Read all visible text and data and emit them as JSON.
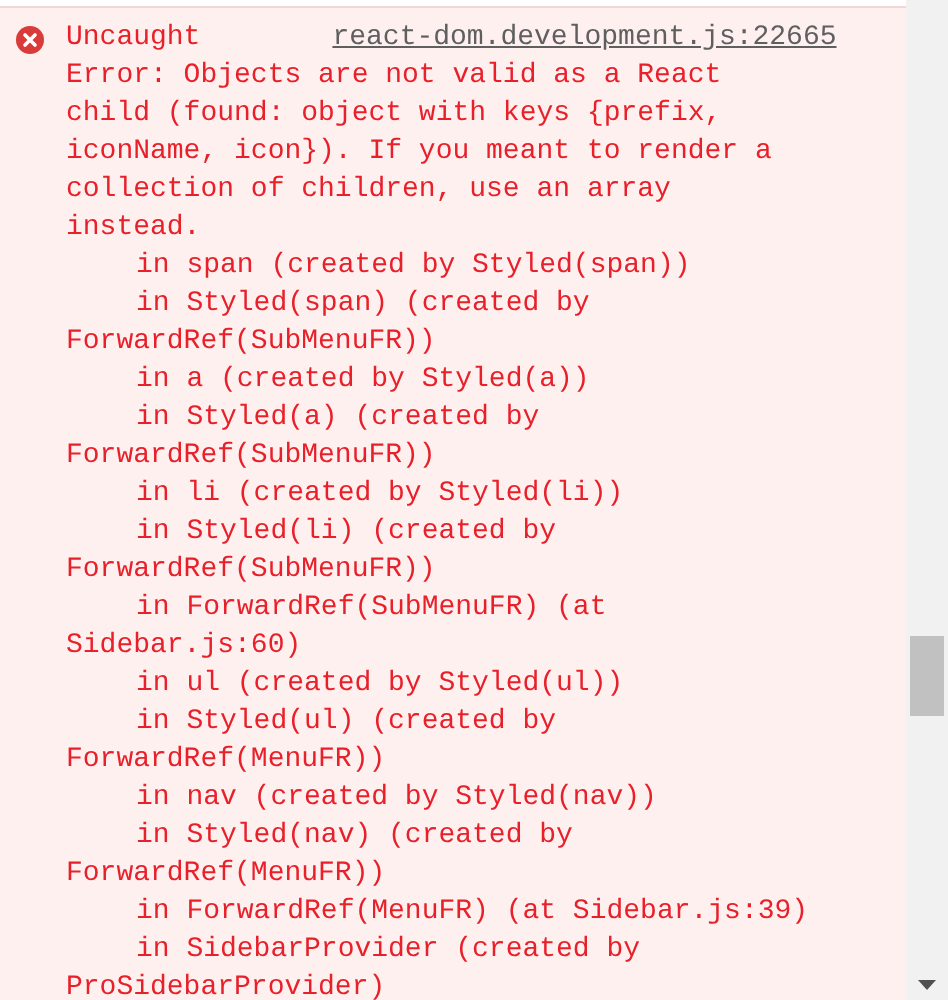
{
  "error": {
    "label": "Uncaught",
    "source_link": "react-dom.development.js:22665",
    "lines": [
      {
        "text": "Error: Objects are not valid as a React",
        "kind": "plain"
      },
      {
        "text": "child (found: object with keys {prefix,",
        "kind": "plain"
      },
      {
        "text": "iconName, icon}). If you meant to render a",
        "kind": "plain"
      },
      {
        "text": "collection of children, use an array",
        "kind": "plain"
      },
      {
        "text": "instead.",
        "kind": "plain"
      },
      {
        "text": "in span (created by Styled(span))",
        "kind": "indented"
      },
      {
        "text": "in Styled(span) (created by",
        "kind": "indented"
      },
      {
        "text": "ForwardRef(SubMenuFR))",
        "kind": "plain"
      },
      {
        "text": "in a (created by Styled(a))",
        "kind": "indented"
      },
      {
        "text": "in Styled(a) (created by",
        "kind": "indented"
      },
      {
        "text": "ForwardRef(SubMenuFR))",
        "kind": "plain"
      },
      {
        "text": "in li (created by Styled(li))",
        "kind": "indented"
      },
      {
        "text": "in Styled(li) (created by",
        "kind": "indented"
      },
      {
        "text": "ForwardRef(SubMenuFR))",
        "kind": "plain"
      },
      {
        "text": "in ForwardRef(SubMenuFR) (at",
        "kind": "indented"
      },
      {
        "text": "Sidebar.js:60)",
        "kind": "plain"
      },
      {
        "text": "in ul (created by Styled(ul))",
        "kind": "indented"
      },
      {
        "text": "in Styled(ul) (created by",
        "kind": "indented"
      },
      {
        "text": "ForwardRef(MenuFR))",
        "kind": "plain"
      },
      {
        "text": "in nav (created by Styled(nav))",
        "kind": "indented"
      },
      {
        "text": "in Styled(nav) (created by",
        "kind": "indented"
      },
      {
        "text": "ForwardRef(MenuFR))",
        "kind": "plain"
      },
      {
        "text": "in ForwardRef(MenuFR) (at Sidebar.js:39)",
        "kind": "indented"
      },
      {
        "text": "in SidebarProvider (created by",
        "kind": "indented"
      },
      {
        "text": "ProSidebarProvider)",
        "kind": "plain"
      }
    ]
  }
}
